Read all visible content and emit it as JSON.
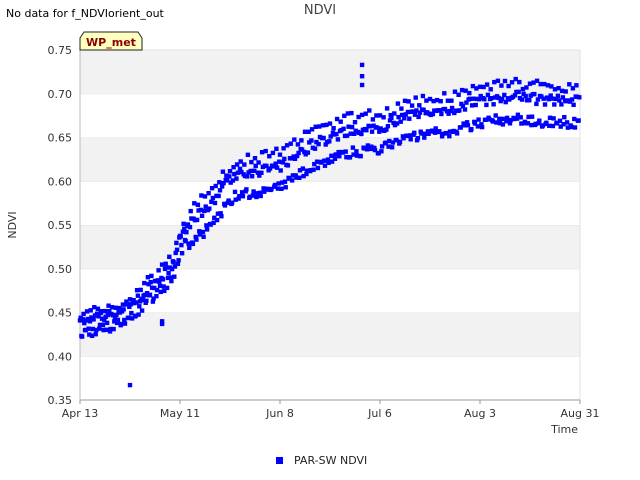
{
  "header": {
    "no_data_text": "No data for f_NDVIorient_out",
    "title": "NDVI"
  },
  "badge": {
    "label": "WP_met"
  },
  "legend": {
    "label": "PAR-SW NDVI"
  },
  "colors": {
    "series": "#0000ff",
    "band": "#f2f2f2",
    "badge_fill": "#ffffc0",
    "badge_text": "#8b0000"
  },
  "chart_data": {
    "type": "scatter",
    "title": "NDVI",
    "xlabel": "Time",
    "ylabel": "NDVI",
    "ylim": [
      0.35,
      0.75
    ],
    "yticks": [
      0.35,
      0.4,
      0.45,
      0.5,
      0.55,
      0.6,
      0.65,
      0.7,
      0.75
    ],
    "xrange": [
      "Apr 13",
      "Aug 31"
    ],
    "xticks": [
      {
        "label": "Apr 13",
        "day": 0
      },
      {
        "label": "May 11",
        "day": 28
      },
      {
        "label": "Jun 8",
        "day": 56
      },
      {
        "label": "Jul 6",
        "day": 84
      },
      {
        "label": "Aug 3",
        "day": 112
      },
      {
        "label": "Aug 31",
        "day": 140
      }
    ],
    "grid": "alternating horizontal bands",
    "legend_position": "bottom-center",
    "series": [
      {
        "name": "PAR-SW NDVI",
        "approx_trend": [
          {
            "x": "Apr 13",
            "y": 0.435
          },
          {
            "x": "Apr 23",
            "y": 0.445
          },
          {
            "x": "Apr 28",
            "y": 0.455
          },
          {
            "x": "May 1",
            "y": 0.47
          },
          {
            "x": "May 4",
            "y": 0.48
          },
          {
            "x": "May 9",
            "y": 0.5
          },
          {
            "x": "May 11",
            "y": 0.53
          },
          {
            "x": "May 15",
            "y": 0.55
          },
          {
            "x": "May 18",
            "y": 0.56
          },
          {
            "x": "May 26",
            "y": 0.6
          },
          {
            "x": "Jun 8",
            "y": 0.61
          },
          {
            "x": "Jun 17",
            "y": 0.635
          },
          {
            "x": "Jun 27",
            "y": 0.65
          },
          {
            "x": "Jul 6",
            "y": 0.655
          },
          {
            "x": "Jul 16",
            "y": 0.67
          },
          {
            "x": "Jul 26",
            "y": 0.675
          },
          {
            "x": "Aug 3",
            "y": 0.685
          },
          {
            "x": "Aug 13",
            "y": 0.69
          },
          {
            "x": "Aug 23",
            "y": 0.685
          },
          {
            "x": "Aug 31",
            "y": 0.685
          }
        ],
        "notable_points": [
          {
            "x": "Apr 27",
            "y": 0.367
          },
          {
            "x": "May 6",
            "y": 0.44
          },
          {
            "x": "May 6",
            "y": 0.437
          },
          {
            "x": "Jul 1",
            "y": 0.733
          },
          {
            "x": "Jul 1",
            "y": 0.72
          },
          {
            "x": "Jul 1",
            "y": 0.71
          }
        ]
      }
    ]
  }
}
